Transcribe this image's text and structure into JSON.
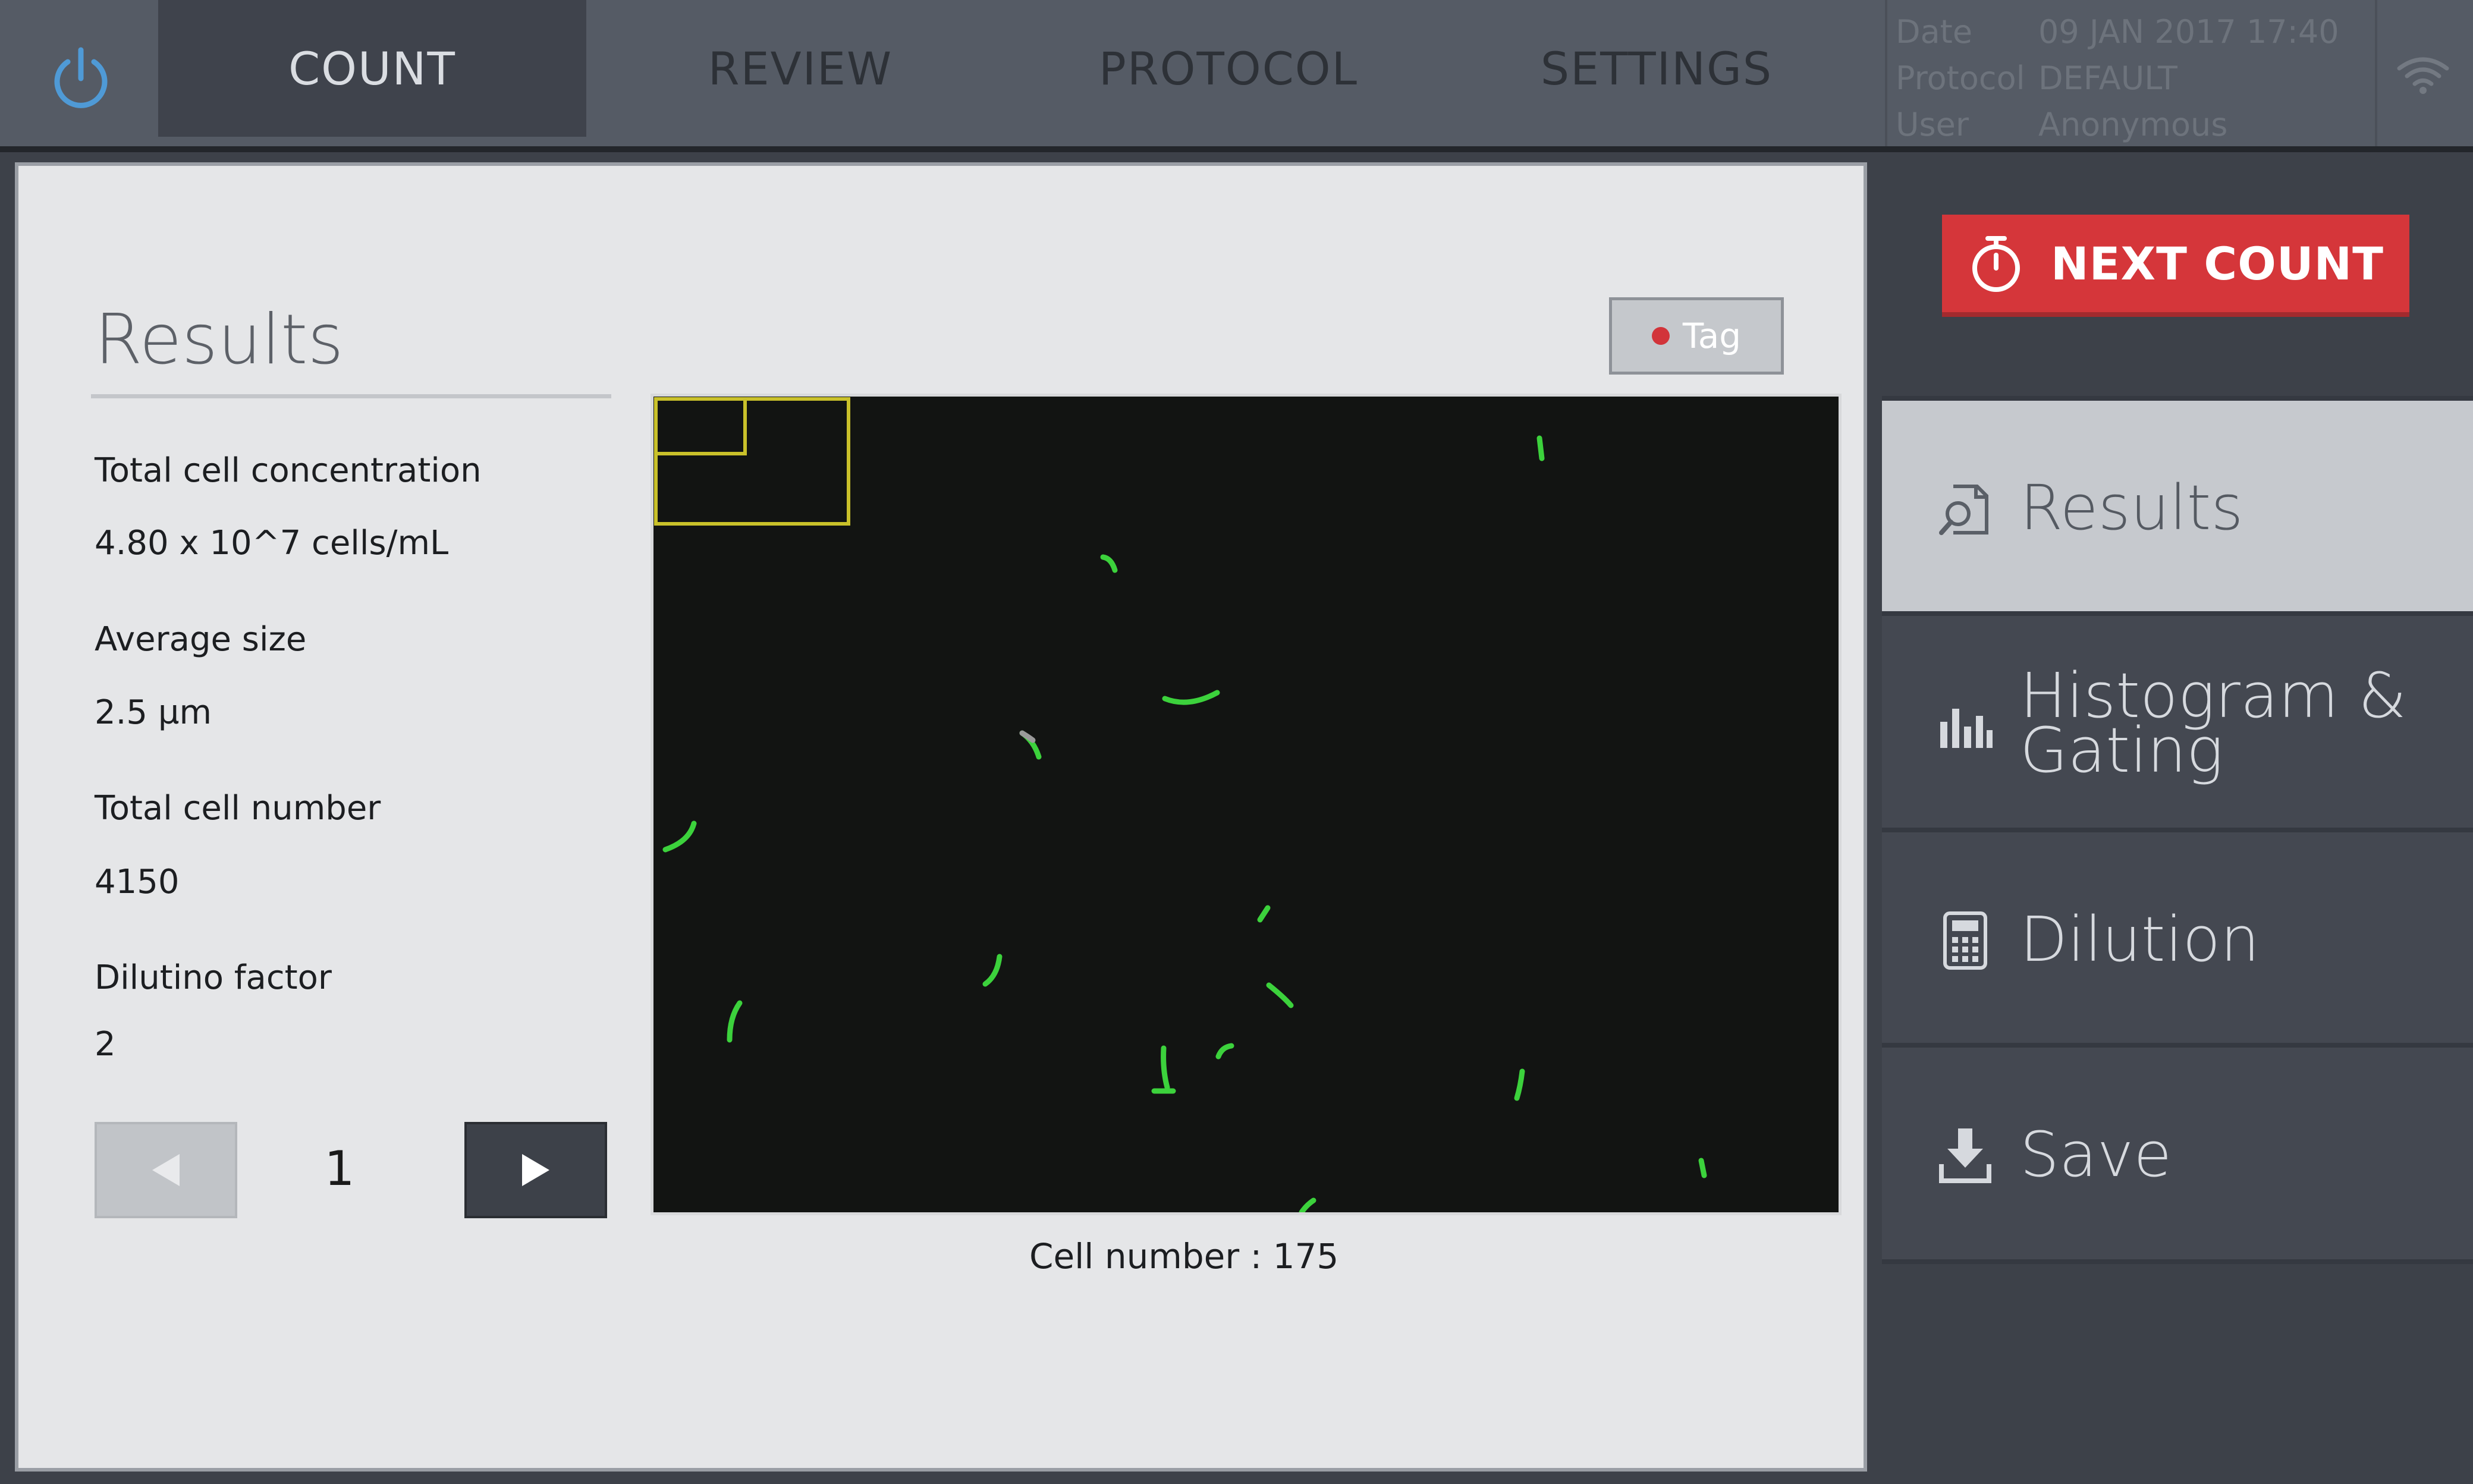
{
  "header": {
    "tabs": [
      {
        "label": "COUNT",
        "active": true
      },
      {
        "label": "REVIEW",
        "active": false
      },
      {
        "label": "PROTOCOL",
        "active": false
      },
      {
        "label": "SETTINGS",
        "active": false
      }
    ],
    "status": {
      "date_label": "Date",
      "date_value": "09 JAN 2017 17:40",
      "protocol_label": "Protocol",
      "protocol_value": "DEFAULT",
      "user_label": "User",
      "user_value": "Anonymous"
    },
    "icons": {
      "power": "power-icon",
      "wifi": "wifi-icon"
    }
  },
  "results": {
    "title": "Results",
    "total_concentration_label": "Total  cell  concentration",
    "total_concentration_value": "4.80 x 10^7  cells/mL",
    "average_size_label": "Average   size",
    "average_size_value": "2.5   µm",
    "total_cell_number_label": "Total  cell  number",
    "total_cell_number_value": "4150",
    "dilution_factor_label": "Dilutino   factor",
    "dilution_factor_value": "2",
    "page": "1"
  },
  "image_panel": {
    "tag_label": "Tag",
    "cell_number_text": "Cell number  :  175"
  },
  "sidebar": {
    "next_count_label": "NEXT COUNT",
    "items": [
      {
        "label": "Results",
        "icon": "search-document-icon",
        "active": true
      },
      {
        "label": "Histogram &",
        "label2": "Gating",
        "icon": "bar-chart-icon",
        "active": false
      },
      {
        "label": "Dilution",
        "icon": "calculator-icon",
        "active": false
      },
      {
        "label": "Save",
        "icon": "download-icon",
        "active": false
      }
    ]
  },
  "colors": {
    "accent_red": "#d5363a",
    "cell_green": "#3cd23c",
    "roi_yellow": "#c9c12a",
    "topbar": "#555b65",
    "sidebar": "#3d4149"
  }
}
